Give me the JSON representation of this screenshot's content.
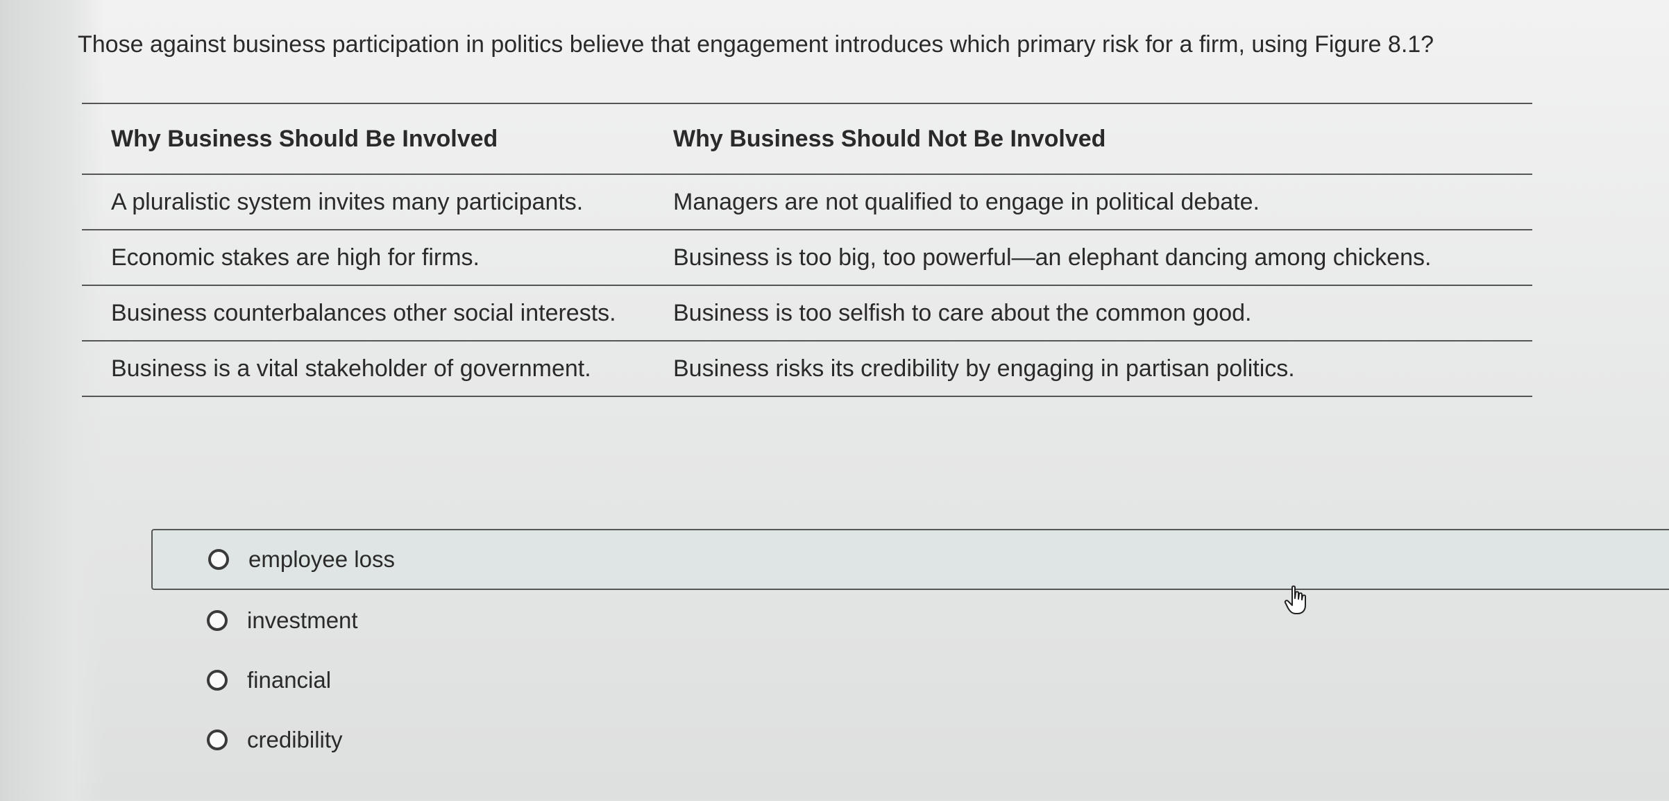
{
  "question": {
    "text": "Those against business participation in politics believe that engagement introduces which primary risk for a firm, using Figure 8.1?"
  },
  "figure": {
    "headers": [
      "Why Business Should Be Involved",
      "Why Business Should Not Be Involved"
    ],
    "rows": [
      [
        "A pluralistic system invites many participants.",
        "Managers are not qualified to engage in political debate."
      ],
      [
        "Economic stakes are high for firms.",
        "Business is too big, too powerful—an elephant dancing among chickens."
      ],
      [
        "Business counterbalances other social interests.",
        "Business is too selfish to care about the common good."
      ],
      [
        "Business is a vital stakeholder of government.",
        "Business risks its credibility by engaging in partisan politics."
      ]
    ]
  },
  "options": [
    {
      "label": "employee loss",
      "hovered": true
    },
    {
      "label": "investment",
      "hovered": false
    },
    {
      "label": "financial",
      "hovered": false
    },
    {
      "label": "credibility",
      "hovered": false
    }
  ],
  "colors": {
    "hover_background": "#dfe5e4",
    "rule": "#555555"
  }
}
